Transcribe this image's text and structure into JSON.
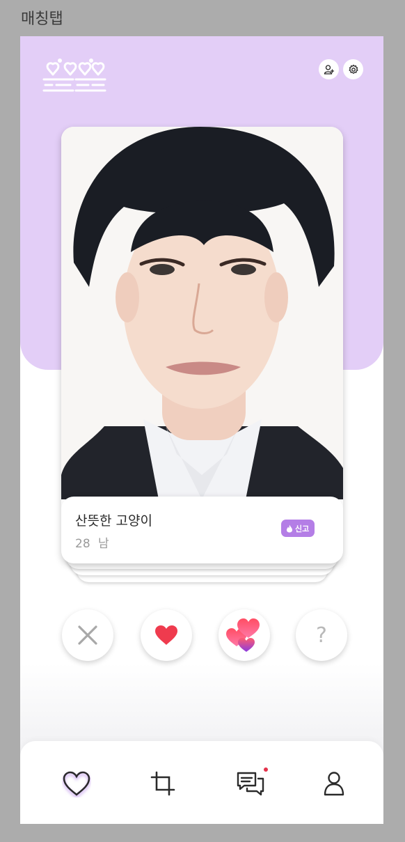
{
  "frame": {
    "label": "매칭탭"
  },
  "header": {
    "logo_icon": "couple-hearts-logo",
    "profile_icon": "add-user-icon",
    "settings_icon": "gear-icon"
  },
  "profile_card": {
    "nickname": "산뜻한 고양이",
    "age": "28",
    "gender": "남",
    "report_label": "신고",
    "report_color": "#b47ee6"
  },
  "actions": {
    "pass_icon": "close-icon",
    "like_icon": "heart-icon",
    "super_like_icon": "double-heart-icon",
    "help_label": "?"
  },
  "bottom_nav": {
    "items": [
      {
        "icon": "heart-outline-icon",
        "active": true
      },
      {
        "icon": "crop-icon",
        "active": false
      },
      {
        "icon": "chat-icon",
        "active": false,
        "has_badge": true
      },
      {
        "icon": "user-icon",
        "active": false
      }
    ]
  },
  "colors": {
    "accent": "#e3cef7",
    "like": "#ef3b4e",
    "frame_background": "#acacac"
  }
}
